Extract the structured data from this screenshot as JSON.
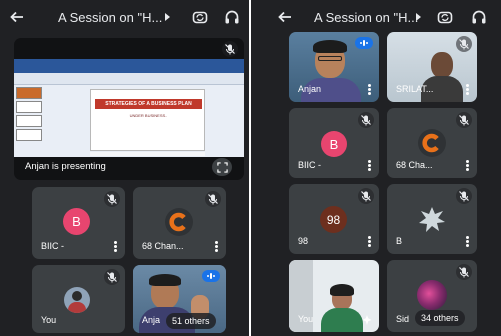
{
  "left": {
    "header": {
      "title": "A Session on \"H..."
    },
    "presentation": {
      "presenter_caption": "Anjan is presenting",
      "slide_title": "STRATEGIES OF A BUSINESS PLAN",
      "slide_subtitle": "UNDER BUSINESS.."
    },
    "tiles": [
      {
        "name": "BIIC -",
        "letter": "B",
        "type": "letter"
      },
      {
        "name": "68 Chan...",
        "type": "logo"
      },
      {
        "name": "You",
        "type": "self"
      },
      {
        "name": "Anja",
        "type": "video-speaking",
        "others": "51 others"
      }
    ]
  },
  "right": {
    "header": {
      "title": "A Session on \"H..."
    },
    "tiles": [
      {
        "name": "Anjan",
        "type": "video-speaking"
      },
      {
        "name": "SRILAT...",
        "type": "video"
      },
      {
        "name": "BIIC -",
        "letter": "B",
        "type": "letter"
      },
      {
        "name": "68 Cha...",
        "type": "logo"
      },
      {
        "name": "98",
        "letter": "98",
        "type": "letter"
      },
      {
        "name": "B",
        "type": "splat"
      },
      {
        "name": "You",
        "type": "self-video"
      },
      {
        "name": "Sid",
        "type": "photo",
        "others": "34 others"
      }
    ]
  },
  "colors": {
    "background": "#202124",
    "tile": "#3c4043",
    "biic_avatar": "#e8456f",
    "num_avatar": "#6d2f1e",
    "logo_orange": "#e8711a",
    "speaking_blue": "#1a73e8"
  },
  "icons": [
    "back-arrow-icon",
    "chevron-right-icon",
    "switch-camera-icon",
    "headphones-icon",
    "mic-off-icon",
    "more-vert-icon",
    "fullscreen-icon"
  ]
}
